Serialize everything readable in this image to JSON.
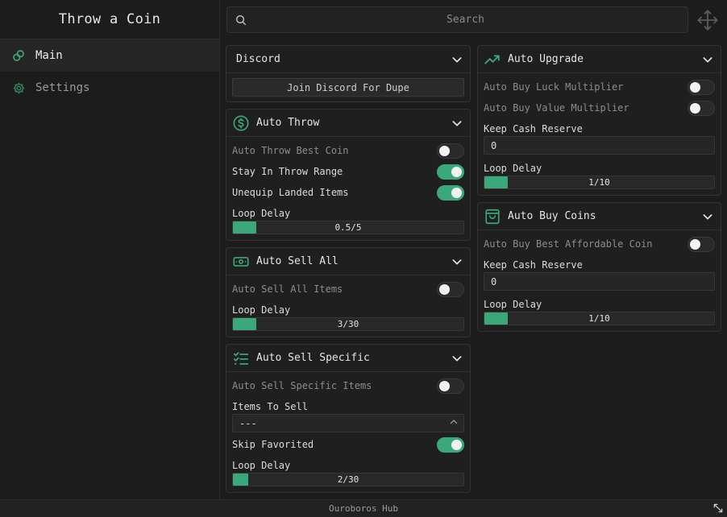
{
  "app": {
    "title": "Throw a Coin",
    "footer": "Ouroboros Hub"
  },
  "colors": {
    "accent": "#3aa87a",
    "bg": "#1c1c1c",
    "panel": "#1f1f1f"
  },
  "sidebar": {
    "items": [
      {
        "label": "Main",
        "icon": "link-icon",
        "active": true
      },
      {
        "label": "Settings",
        "icon": "gear-icon",
        "active": false
      }
    ]
  },
  "search": {
    "placeholder": "Search"
  },
  "left": {
    "discord": {
      "title": "Discord",
      "button": "Join Discord For Dupe"
    },
    "auto_throw": {
      "title": "Auto Throw",
      "icon": "dollar-circle-icon",
      "best_coin": {
        "label": "Auto Throw Best Coin",
        "on": false
      },
      "stay_range": {
        "label": "Stay In Throw Range",
        "on": true
      },
      "unequip": {
        "label": "Unequip Landed Items",
        "on": true
      },
      "loop_label": "Loop Delay",
      "loop_value": "0.5/5",
      "loop_fraction": 0.1
    },
    "auto_sell_all": {
      "title": "Auto Sell All",
      "icon": "banknote-icon",
      "sell_all": {
        "label": "Auto Sell All Items",
        "on": false
      },
      "loop_label": "Loop Delay",
      "loop_value": "3/30",
      "loop_fraction": 0.1
    },
    "auto_sell_specific": {
      "title": "Auto Sell Specific",
      "icon": "checklist-icon",
      "sell_specific": {
        "label": "Auto Sell Specific Items",
        "on": false
      },
      "items_label": "Items To Sell",
      "items_value": "---",
      "skip_fav": {
        "label": "Skip Favorited",
        "on": true
      },
      "loop_label": "Loop Delay",
      "loop_value": "2/30",
      "loop_fraction": 0.067
    }
  },
  "right": {
    "auto_upgrade": {
      "title": "Auto Upgrade",
      "icon": "trending-up-icon",
      "luck": {
        "label": "Auto Buy Luck Multiplier",
        "on": false
      },
      "value": {
        "label": "Auto Buy Value Multiplier",
        "on": false
      },
      "reserve_label": "Keep Cash Reserve",
      "reserve_value": "0",
      "loop_label": "Loop Delay",
      "loop_value": "1/10",
      "loop_fraction": 0.1
    },
    "auto_buy_coins": {
      "title": "Auto Buy Coins",
      "icon": "shopping-bag-icon",
      "best_affordable": {
        "label": "Auto Buy Best Affordable Coin",
        "on": false
      },
      "reserve_label": "Keep Cash Reserve",
      "reserve_value": "0",
      "loop_label": "Loop Delay",
      "loop_value": "1/10",
      "loop_fraction": 0.1
    }
  }
}
